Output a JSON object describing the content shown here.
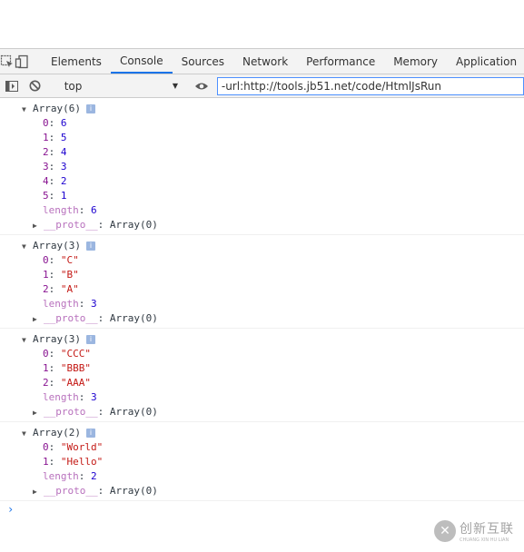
{
  "tabs": [
    "Elements",
    "Console",
    "Sources",
    "Network",
    "Performance",
    "Memory",
    "Application"
  ],
  "active_tab": "Console",
  "toolbar": {
    "context": "top",
    "filter_value": "-url:http://tools.jb51.net/code/HtmlJsRun"
  },
  "messages": [
    {
      "header": "Array(6)",
      "items": [
        {
          "index": "0",
          "value": "6",
          "kind": "num"
        },
        {
          "index": "1",
          "value": "5",
          "kind": "num"
        },
        {
          "index": "2",
          "value": "4",
          "kind": "num"
        },
        {
          "index": "3",
          "value": "3",
          "kind": "num"
        },
        {
          "index": "4",
          "value": "2",
          "kind": "num"
        },
        {
          "index": "5",
          "value": "1",
          "kind": "num"
        }
      ],
      "length": "6",
      "proto": "Array(0)"
    },
    {
      "header": "Array(3)",
      "items": [
        {
          "index": "0",
          "value": "\"C\"",
          "kind": "str"
        },
        {
          "index": "1",
          "value": "\"B\"",
          "kind": "str"
        },
        {
          "index": "2",
          "value": "\"A\"",
          "kind": "str"
        }
      ],
      "length": "3",
      "proto": "Array(0)"
    },
    {
      "header": "Array(3)",
      "items": [
        {
          "index": "0",
          "value": "\"CCC\"",
          "kind": "str"
        },
        {
          "index": "1",
          "value": "\"BBB\"",
          "kind": "str"
        },
        {
          "index": "2",
          "value": "\"AAA\"",
          "kind": "str"
        }
      ],
      "length": "3",
      "proto": "Array(0)"
    },
    {
      "header": "Array(2)",
      "items": [
        {
          "index": "0",
          "value": "\"World\"",
          "kind": "str"
        },
        {
          "index": "1",
          "value": "\"Hello\"",
          "kind": "str"
        }
      ],
      "length": "2",
      "proto": "Array(0)"
    }
  ],
  "labels": {
    "length_key": "length",
    "proto_key": "__proto__",
    "info_badge": "i",
    "prompt": "›"
  },
  "watermark": {
    "cn": "创新互联",
    "en": "CHUANG XIN HU LIAN"
  },
  "colors": {
    "accent": "#1a73e8",
    "key": "#881391",
    "number": "#1c00cf",
    "string": "#c41a16"
  },
  "icons": [
    "inspect-element-icon",
    "device-toolbar-icon",
    "sidebar-toggle-icon",
    "clear-console-icon",
    "dropdown-arrow-icon",
    "eye-icon",
    "expand-triangle-icon",
    "collapsed-triangle-icon",
    "info-badge-icon",
    "prompt-chevron-icon"
  ]
}
